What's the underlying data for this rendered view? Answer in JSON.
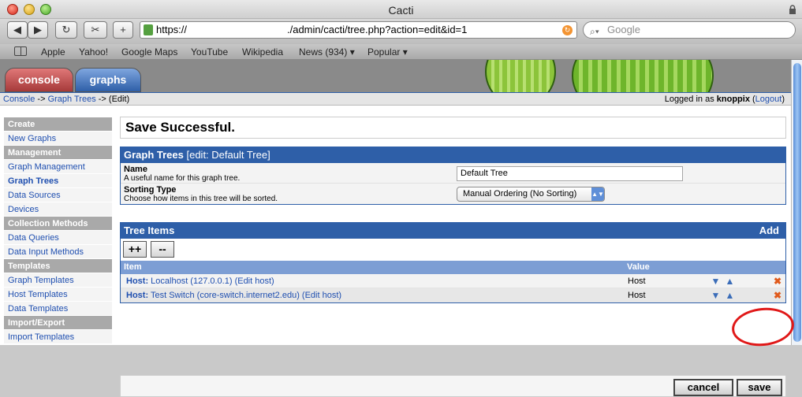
{
  "window": {
    "title": "Cacti"
  },
  "toolbar": {
    "back": "◀",
    "forward": "▶",
    "reload": "↻",
    "snip": "✂",
    "add": "+",
    "url_protocol": "https://",
    "url_path": "./admin/cacti/tree.php?action=edit&id=1",
    "search_placeholder": "Google"
  },
  "bookmarks": [
    {
      "label": "Apple"
    },
    {
      "label": "Yahoo!"
    },
    {
      "label": "Google Maps"
    },
    {
      "label": "YouTube"
    },
    {
      "label": "Wikipedia"
    },
    {
      "label": "News (934) ▾"
    },
    {
      "label": "Popular ▾"
    }
  ],
  "tabs": {
    "console": "console",
    "graphs": "graphs"
  },
  "breadcrumb": {
    "console": "Console",
    "sep1": " -> ",
    "graph_trees": "Graph Trees",
    "sep2": " -> (Edit)"
  },
  "login": {
    "prefix": "Logged in as ",
    "user": "knoppix",
    "open": " (",
    "logout": "Logout",
    "close": ")"
  },
  "sidebar": {
    "create": "Create",
    "new_graphs": "New Graphs",
    "management": "Management",
    "graph_management": "Graph Management",
    "graph_trees": "Graph Trees",
    "data_sources": "Data Sources",
    "devices": "Devices",
    "collection_methods": "Collection Methods",
    "data_queries": "Data Queries",
    "data_input_methods": "Data Input Methods",
    "templates": "Templates",
    "graph_templates": "Graph Templates",
    "host_templates": "Host Templates",
    "data_templates": "Data Templates",
    "import_export": "Import/Export",
    "import_templates": "Import Templates"
  },
  "message": "Save Successful.",
  "graph_tree_panel": {
    "title": "Graph Trees",
    "subtitle": " [edit: Default Tree]",
    "name_label": "Name",
    "name_desc": "A useful name for this graph tree.",
    "name_value": "Default Tree",
    "sort_label": "Sorting Type",
    "sort_desc": "Choose how items in this tree will be sorted.",
    "sort_value": "Manual Ordering (No Sorting)"
  },
  "tree_items_panel": {
    "title": "Tree Items",
    "add": "Add",
    "expand": "++",
    "collapse": "--",
    "col_item": "Item",
    "col_value": "Value",
    "rows": [
      {
        "type": "Host:",
        "label": " Localhost (127.0.0.1) (Edit host)",
        "value": "Host"
      },
      {
        "type": "Host:",
        "label": " Test Switch (core-switch.internet2.edu) (Edit host)",
        "value": "Host"
      }
    ]
  },
  "actions": {
    "cancel": "cancel",
    "save": "save"
  },
  "colors": {
    "header_blue": "#2e5fa8",
    "link": "#1f4fb0",
    "highlight_circle": "#e01818"
  }
}
